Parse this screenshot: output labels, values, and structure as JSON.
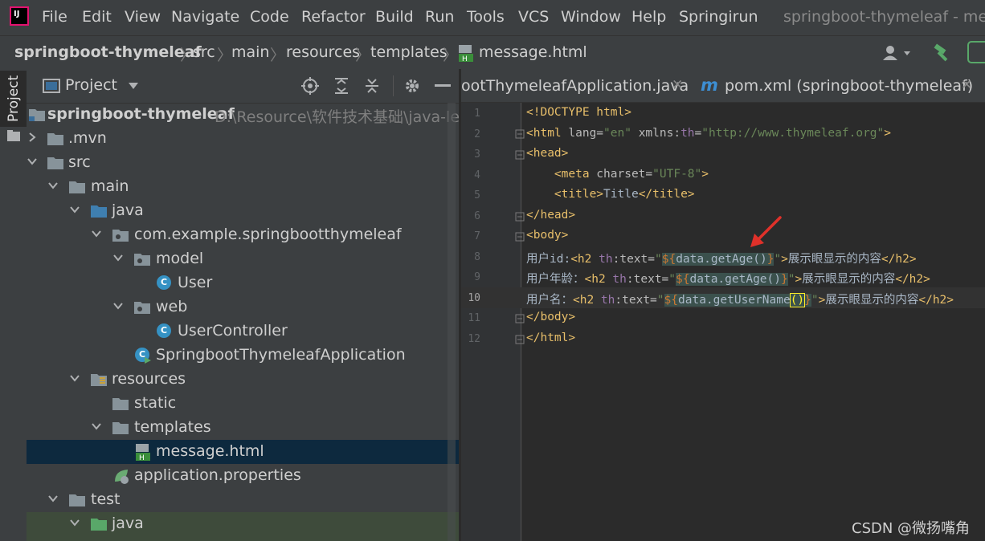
{
  "menubar": {
    "items": [
      "File",
      "Edit",
      "View",
      "Navigate",
      "Code",
      "Refactor",
      "Build",
      "Run",
      "Tools",
      "VCS",
      "Window",
      "Help",
      "Springirun"
    ],
    "window_title": "springboot-thymeleaf - messa"
  },
  "breadcrumb": [
    "springboot-thymeleaf",
    "src",
    "main",
    "resources",
    "templates",
    "message.html"
  ],
  "side_tool": {
    "project_label": "Project"
  },
  "project_panel": {
    "title": "Project",
    "root": {
      "name": "springboot-thymeleaf",
      "path": "D:\\Resource\\软件技术基础\\java-learn"
    },
    "items": [
      {
        "label": ".mvn",
        "icon": "folder-icon"
      },
      {
        "label": "src",
        "icon": "folder-icon"
      },
      {
        "label": "main",
        "icon": "folder-icon"
      },
      {
        "label": "java",
        "icon": "source-folder-icon"
      },
      {
        "label": "com.example.springbootthymeleaf",
        "icon": "package-icon"
      },
      {
        "label": "model",
        "icon": "package-icon"
      },
      {
        "label": "User",
        "icon": "class-icon"
      },
      {
        "label": "web",
        "icon": "package-icon"
      },
      {
        "label": "UserController",
        "icon": "class-icon"
      },
      {
        "label": "SpringbootThymeleafApplication",
        "icon": "spring-boot-class-icon"
      },
      {
        "label": "resources",
        "icon": "resources-folder-icon"
      },
      {
        "label": "static",
        "icon": "folder-icon"
      },
      {
        "label": "templates",
        "icon": "folder-icon"
      },
      {
        "label": "message.html",
        "icon": "html-file-icon"
      },
      {
        "label": "application.properties",
        "icon": "properties-file-icon"
      },
      {
        "label": "test",
        "icon": "folder-icon"
      },
      {
        "label": "java",
        "icon": "test-source-folder-icon"
      }
    ]
  },
  "tabs": [
    {
      "label": "ootThymeleafApplication.java"
    },
    {
      "label": "pom.xml (springboot-thymeleaf)",
      "icon": "maven-icon"
    }
  ],
  "editor": {
    "line_numbers": [
      "1",
      "2",
      "3",
      "4",
      "5",
      "6",
      "7",
      "8",
      "9",
      "10",
      "11",
      "12"
    ],
    "lines": {
      "l1": {
        "p1": "<!DOCTYPE html>"
      },
      "l2": {
        "p1": "<html",
        "p2": " lang=",
        "p3": "\"en\"",
        "p4": " xmlns:",
        "p5": "th",
        "p6": "=",
        "p7": "\"http://www.thymeleaf.org\"",
        "p8": ">"
      },
      "l3": {
        "p1": "<head>"
      },
      "l4": {
        "p1": "    <meta",
        "p2": " charset=",
        "p3": "\"UTF-8\"",
        "p4": ">"
      },
      "l5": {
        "p1": "    <title>",
        "p2": "Title",
        "p3": "</title>"
      },
      "l6": {
        "p1": "</head>"
      },
      "l7": {
        "p1": "<body>"
      },
      "l8": {
        "p1": "用户id:",
        "p2": "<h2",
        "p3": " th",
        "p4": ":text=",
        "p5": "\"",
        "p6": "${",
        "p7": "data.getAge()",
        "p8": "}",
        "p9": "\"",
        "p10": ">",
        "p11": "展示眼显示的内容",
        "p12": "</h2>"
      },
      "l9": {
        "p1": "用户年龄：",
        "p2": "<h2",
        "p3": " th",
        "p4": ":text=",
        "p5": "\"",
        "p6": "${",
        "p7": "data.getAge()",
        "p8": "}",
        "p9": "\"",
        "p10": ">",
        "p11": "展示眼显示的内容",
        "p12": "</h2>"
      },
      "l10": {
        "p1": "用户名：",
        "p2": "<h2",
        "p3": " th",
        "p4": ":text=",
        "p5": "\"",
        "p6": "${",
        "p7": "data.getUserName",
        "p8": "()",
        "p9": "}",
        "p10": "\"",
        "p11": ">",
        "p12": "展示眼显示的内容",
        "p13": "</h2>"
      },
      "l11": {
        "p1": "</body>"
      },
      "l12": {
        "p1": "</html>"
      }
    }
  },
  "watermark": "CSDN @微扬嘴角",
  "colors": {
    "accent_red": "#e0312a",
    "selection": "#0d293e",
    "tag": "#e8bf6a",
    "string": "#6a8759"
  }
}
